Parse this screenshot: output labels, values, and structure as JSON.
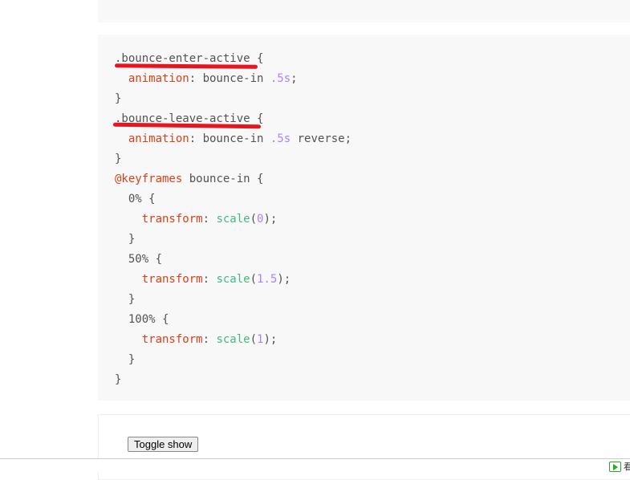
{
  "previous_block": {
    "last_line": "})"
  },
  "code_lines": [
    [
      {
        "t": ".bounce-enter-active {"
      }
    ],
    [
      {
        "t": "  "
      },
      {
        "t": "animation",
        "c": "p"
      },
      {
        "t": ": bounce-in "
      },
      {
        "t": ".5s",
        "c": "n"
      },
      {
        "t": ";"
      }
    ],
    [
      {
        "t": "}"
      }
    ],
    [
      {
        "t": ".bounce-leave-active {"
      }
    ],
    [
      {
        "t": "  "
      },
      {
        "t": "animation",
        "c": "p"
      },
      {
        "t": ": bounce-in "
      },
      {
        "t": ".5s",
        "c": "n"
      },
      {
        "t": " reverse;"
      }
    ],
    [
      {
        "t": "}"
      }
    ],
    [
      {
        "t": "@keyframes",
        "c": "k"
      },
      {
        "t": " bounce-in {"
      }
    ],
    [
      {
        "t": "  0% {"
      }
    ],
    [
      {
        "t": "    "
      },
      {
        "t": "transform",
        "c": "p"
      },
      {
        "t": ": "
      },
      {
        "t": "scale",
        "c": "f"
      },
      {
        "t": "("
      },
      {
        "t": "0",
        "c": "n"
      },
      {
        "t": ");"
      }
    ],
    [
      {
        "t": "  }"
      }
    ],
    [
      {
        "t": "  50% {"
      }
    ],
    [
      {
        "t": "    "
      },
      {
        "t": "transform",
        "c": "p"
      },
      {
        "t": ": "
      },
      {
        "t": "scale",
        "c": "f"
      },
      {
        "t": "("
      },
      {
        "t": "1.5",
        "c": "n"
      },
      {
        "t": ");"
      }
    ],
    [
      {
        "t": "  }"
      }
    ],
    [
      {
        "t": "  100% {"
      }
    ],
    [
      {
        "t": "    "
      },
      {
        "t": "transform",
        "c": "p"
      },
      {
        "t": ": "
      },
      {
        "t": "scale",
        "c": "f"
      },
      {
        "t": "("
      },
      {
        "t": "1",
        "c": "n"
      },
      {
        "t": ");"
      }
    ],
    [
      {
        "t": "  }"
      }
    ],
    [
      {
        "t": "}"
      }
    ]
  ],
  "demo": {
    "toggle_label": "Toggle show"
  },
  "statusbar": {
    "text": "看"
  },
  "colors": {
    "annotation": "#e8141e",
    "property": "#d9401a",
    "number": "#ae81ff",
    "function": "#42b983"
  }
}
